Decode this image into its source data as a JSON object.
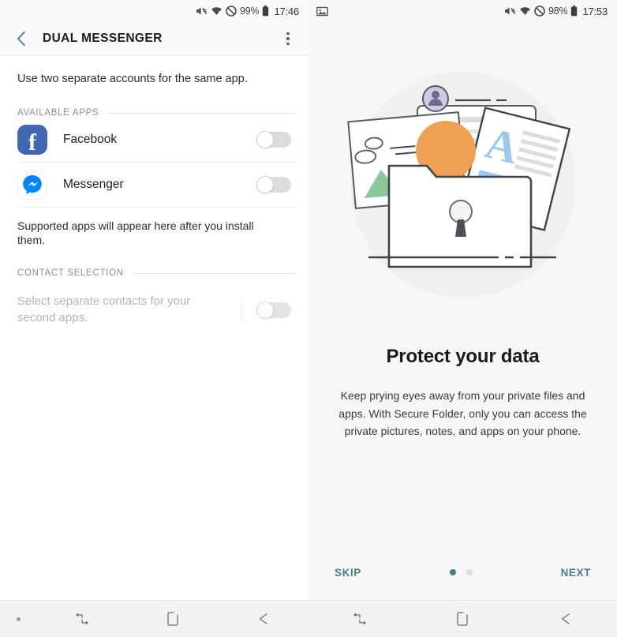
{
  "left": {
    "statusbar": {
      "icons": [
        "mute-icon",
        "wifi-icon",
        "do-not-disturb-icon",
        "battery-icon"
      ],
      "battery": "99%",
      "time": "17:46"
    },
    "appbar": {
      "back": "back-arrow-icon",
      "title": "DUAL MESSENGER",
      "overflow": "more-options-icon"
    },
    "intro": "Use two separate accounts for the same app.",
    "sections": [
      {
        "label": "AVAILABLE APPS"
      },
      {
        "label": "CONTACT SELECTION"
      }
    ],
    "apps": [
      {
        "name": "Facebook",
        "icon": "facebook-icon",
        "toggle": "off"
      },
      {
        "name": "Messenger",
        "icon": "messenger-icon",
        "toggle": "off"
      }
    ],
    "note": "Supported apps will appear here after you install them.",
    "contact": {
      "text": "Select separate contacts for your second apps.",
      "toggle": "off",
      "disabled": true
    }
  },
  "right": {
    "statusbar": {
      "left_icon": "image-icon",
      "icons": [
        "mute-icon",
        "wifi-icon",
        "do-not-disturb-icon",
        "battery-icon"
      ],
      "battery": "98%",
      "time": "17:53"
    },
    "illustration": "secure-folder-illustration",
    "headline": "Protect your data",
    "subtext": "Keep prying eyes away from your private files and apps. With Secure Folder, only you can access the private pictures, notes, and apps on your phone.",
    "skip_label": "SKIP",
    "next_label": "NEXT",
    "pagination": {
      "total": 2,
      "active": 0
    }
  },
  "navbar": {
    "items": [
      "recents-icon",
      "home-icon",
      "back-icon"
    ]
  },
  "colors": {
    "accent": "#477d88",
    "facebook_blue": "#4267b2",
    "messenger_blue": "#0084ff",
    "toggle_track": "#dcdcdc",
    "illus_bg": "#f0f0f0",
    "illus_orange": "#f0a052",
    "illus_blue": "#9cc8ec",
    "illus_purple": "#cfc9e8",
    "illus_green": "#8cc79a"
  }
}
